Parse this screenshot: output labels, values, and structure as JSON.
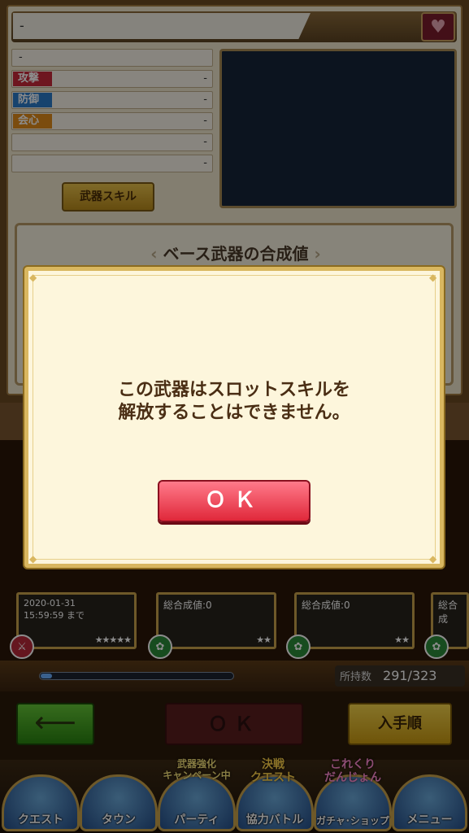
{
  "weapon_detail": {
    "name_placeholder": "-",
    "subname": "-",
    "stats": [
      {
        "tag": "",
        "value": "-"
      },
      {
        "tag": "攻撃",
        "value": "-",
        "color": "#c8283a"
      },
      {
        "tag": "防御",
        "value": "-",
        "color": "#2a7ac8"
      },
      {
        "tag": "会心",
        "value": "-",
        "color": "#e08a1a"
      },
      {
        "tag": "",
        "value": "-"
      },
      {
        "tag": "",
        "value": "-"
      }
    ],
    "skill_button": "武器スキル",
    "synthesis_title": "ベース武器の合成値"
  },
  "grid": {
    "cards": [
      {
        "label": "2020-01-31\n15:59:59 まで",
        "stars": "★★★★★"
      },
      {
        "label": "総合成値:0",
        "stars": "★★"
      },
      {
        "label": "総合成値:0",
        "stars": "★★"
      },
      {
        "label": "総合成",
        "stars": ""
      }
    ],
    "right_labels": [
      "総合成",
      "総合成"
    ]
  },
  "status": {
    "count_label": "所持数",
    "count_value": "291/323",
    "progress_fraction": 0.06
  },
  "buttons": {
    "back": "⟵",
    "ok": "ＯＫ",
    "sort": "入手順"
  },
  "nav": {
    "items": [
      "クエスト",
      "タウン",
      "パーティ",
      "協力バトル",
      "ガチャ･ショップ",
      "メニュー"
    ],
    "badges": [
      "武器強化\nキャンペーン中",
      "決戦\nクエスト",
      "これくり\nだんじょん"
    ]
  },
  "dialog": {
    "message_line1": "この武器はスロットスキルを",
    "message_line2": "解放することはできません。",
    "ok_label": "ＯＫ"
  }
}
